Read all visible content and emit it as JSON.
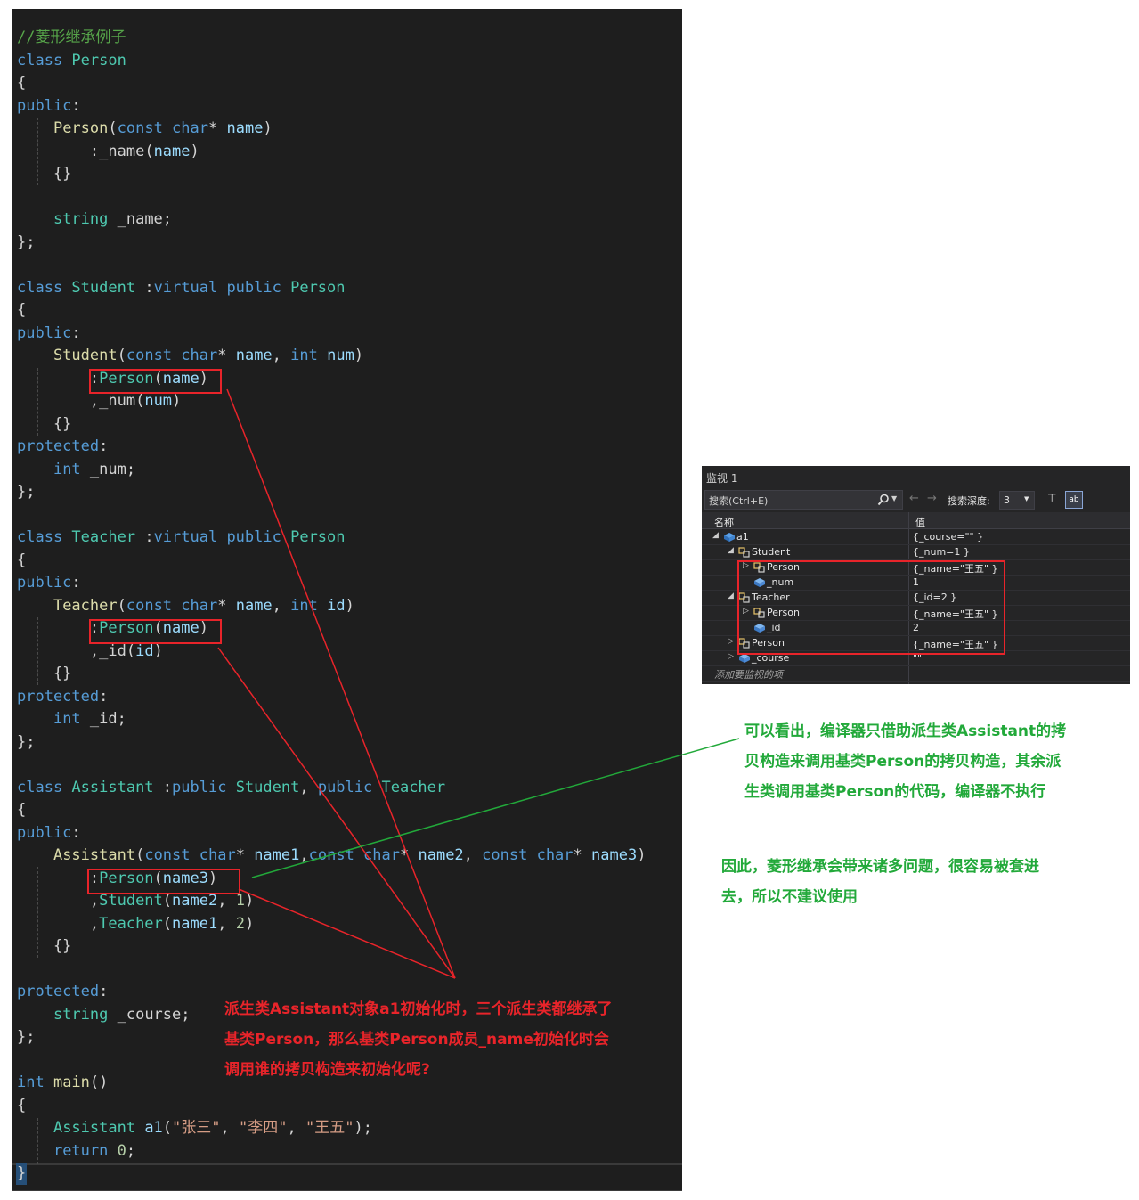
{
  "code_lines": [
    [
      [
        "cm",
        "//菱形继承例子"
      ]
    ],
    [
      [
        "kw",
        "class "
      ],
      [
        "ty",
        "Person"
      ]
    ],
    [
      [
        "pl",
        "{"
      ]
    ],
    [
      [
        "kw",
        "public"
      ],
      [
        "pl",
        ":"
      ]
    ],
    [
      [
        "pl",
        "    "
      ],
      [
        "fn",
        "Person"
      ],
      [
        "pl",
        "("
      ],
      [
        "kw",
        "const "
      ],
      [
        "kw",
        "char"
      ],
      [
        "pl",
        "* "
      ],
      [
        "pr",
        "name"
      ],
      [
        "pl",
        ")"
      ]
    ],
    [
      [
        "pl",
        "        :"
      ],
      [
        "pl",
        "_name"
      ],
      [
        "pl",
        "("
      ],
      [
        "pr",
        "name"
      ],
      [
        "pl",
        ")"
      ]
    ],
    [
      [
        "pl",
        "    {}"
      ]
    ],
    [
      [
        "pl",
        ""
      ]
    ],
    [
      [
        "pl",
        "    "
      ],
      [
        "ty",
        "string "
      ],
      [
        "pl",
        "_name;"
      ]
    ],
    [
      [
        "pl",
        "};"
      ]
    ],
    [
      [
        "pl",
        ""
      ]
    ],
    [
      [
        "kw",
        "class "
      ],
      [
        "ty",
        "Student "
      ],
      [
        "pl",
        ":"
      ],
      [
        "kw",
        "virtual public "
      ],
      [
        "ty",
        "Person"
      ]
    ],
    [
      [
        "pl",
        "{"
      ]
    ],
    [
      [
        "kw",
        "public"
      ],
      [
        "pl",
        ":"
      ]
    ],
    [
      [
        "pl",
        "    "
      ],
      [
        "fn",
        "Student"
      ],
      [
        "pl",
        "("
      ],
      [
        "kw",
        "const "
      ],
      [
        "kw",
        "char"
      ],
      [
        "pl",
        "* "
      ],
      [
        "pr",
        "name"
      ],
      [
        "pl",
        ", "
      ],
      [
        "kw",
        "int "
      ],
      [
        "pr",
        "num"
      ],
      [
        "pl",
        ")"
      ]
    ],
    [
      [
        "pl",
        "        :"
      ],
      [
        "ty",
        "Person"
      ],
      [
        "pl",
        "("
      ],
      [
        "pr",
        "name"
      ],
      [
        "pl",
        ")"
      ]
    ],
    [
      [
        "pl",
        "        ,"
      ],
      [
        "pl",
        "_num"
      ],
      [
        "pl",
        "("
      ],
      [
        "pr",
        "num"
      ],
      [
        "pl",
        ")"
      ]
    ],
    [
      [
        "pl",
        "    {}"
      ]
    ],
    [
      [
        "kw",
        "protected"
      ],
      [
        "pl",
        ":"
      ]
    ],
    [
      [
        "pl",
        "    "
      ],
      [
        "kw",
        "int "
      ],
      [
        "pl",
        "_num;"
      ]
    ],
    [
      [
        "pl",
        "};"
      ]
    ],
    [
      [
        "pl",
        ""
      ]
    ],
    [
      [
        "kw",
        "class "
      ],
      [
        "ty",
        "Teacher "
      ],
      [
        "pl",
        ":"
      ],
      [
        "kw",
        "virtual public "
      ],
      [
        "ty",
        "Person"
      ]
    ],
    [
      [
        "pl",
        "{"
      ]
    ],
    [
      [
        "kw",
        "public"
      ],
      [
        "pl",
        ":"
      ]
    ],
    [
      [
        "pl",
        "    "
      ],
      [
        "fn",
        "Teacher"
      ],
      [
        "pl",
        "("
      ],
      [
        "kw",
        "const "
      ],
      [
        "kw",
        "char"
      ],
      [
        "pl",
        "* "
      ],
      [
        "pr",
        "name"
      ],
      [
        "pl",
        ", "
      ],
      [
        "kw",
        "int "
      ],
      [
        "pr",
        "id"
      ],
      [
        "pl",
        ")"
      ]
    ],
    [
      [
        "pl",
        "        :"
      ],
      [
        "ty",
        "Person"
      ],
      [
        "pl",
        "("
      ],
      [
        "pr",
        "name"
      ],
      [
        "pl",
        ")"
      ]
    ],
    [
      [
        "pl",
        "        ,"
      ],
      [
        "pl",
        "_id"
      ],
      [
        "pl",
        "("
      ],
      [
        "pr",
        "id"
      ],
      [
        "pl",
        ")"
      ]
    ],
    [
      [
        "pl",
        "    {}"
      ]
    ],
    [
      [
        "kw",
        "protected"
      ],
      [
        "pl",
        ":"
      ]
    ],
    [
      [
        "pl",
        "    "
      ],
      [
        "kw",
        "int "
      ],
      [
        "pl",
        "_id;"
      ]
    ],
    [
      [
        "pl",
        "};"
      ]
    ],
    [
      [
        "pl",
        ""
      ]
    ],
    [
      [
        "kw",
        "class "
      ],
      [
        "ty",
        "Assistant "
      ],
      [
        "pl",
        ":"
      ],
      [
        "kw",
        "public "
      ],
      [
        "ty",
        "Student"
      ],
      [
        "pl",
        ", "
      ],
      [
        "kw",
        "public "
      ],
      [
        "ty",
        "Teacher"
      ]
    ],
    [
      [
        "pl",
        "{"
      ]
    ],
    [
      [
        "kw",
        "public"
      ],
      [
        "pl",
        ":"
      ]
    ],
    [
      [
        "pl",
        "    "
      ],
      [
        "fn",
        "Assistant"
      ],
      [
        "pl",
        "("
      ],
      [
        "kw",
        "const "
      ],
      [
        "kw",
        "char"
      ],
      [
        "pl",
        "* "
      ],
      [
        "pr",
        "name1"
      ],
      [
        "pl",
        ","
      ],
      [
        "kw",
        "const "
      ],
      [
        "kw",
        "char"
      ],
      [
        "pl",
        "* "
      ],
      [
        "pr",
        "name2"
      ],
      [
        "pl",
        ", "
      ],
      [
        "kw",
        "const "
      ],
      [
        "kw",
        "char"
      ],
      [
        "pl",
        "* "
      ],
      [
        "pr",
        "name3"
      ],
      [
        "pl",
        ")"
      ]
    ],
    [
      [
        "pl",
        "        :"
      ],
      [
        "ty",
        "Person"
      ],
      [
        "pl",
        "("
      ],
      [
        "pr",
        "name3"
      ],
      [
        "pl",
        ")"
      ]
    ],
    [
      [
        "pl",
        "        ,"
      ],
      [
        "ty",
        "Student"
      ],
      [
        "pl",
        "("
      ],
      [
        "pr",
        "name2"
      ],
      [
        "pl",
        ", "
      ],
      [
        "nu",
        "1"
      ],
      [
        "pl",
        ")"
      ]
    ],
    [
      [
        "pl",
        "        ,"
      ],
      [
        "ty",
        "Teacher"
      ],
      [
        "pl",
        "("
      ],
      [
        "pr",
        "name1"
      ],
      [
        "pl",
        ", "
      ],
      [
        "nu",
        "2"
      ],
      [
        "pl",
        ")"
      ]
    ],
    [
      [
        "pl",
        "    {}"
      ]
    ],
    [
      [
        "pl",
        ""
      ]
    ],
    [
      [
        "kw",
        "protected"
      ],
      [
        "pl",
        ":"
      ]
    ],
    [
      [
        "pl",
        "    "
      ],
      [
        "ty",
        "string "
      ],
      [
        "pl",
        "_course;"
      ]
    ],
    [
      [
        "pl",
        "};"
      ]
    ],
    [
      [
        "pl",
        ""
      ]
    ],
    [
      [
        "kw",
        "int "
      ],
      [
        "fn",
        "main"
      ],
      [
        "pl",
        "()"
      ]
    ],
    [
      [
        "pl",
        "{"
      ]
    ],
    [
      [
        "pl",
        "    "
      ],
      [
        "ty",
        "Assistant "
      ],
      [
        "pr",
        "a1"
      ],
      [
        "pl",
        "("
      ],
      [
        "st",
        "\"张三\""
      ],
      [
        "pl",
        ", "
      ],
      [
        "st",
        "\"李四\""
      ],
      [
        "pl",
        ", "
      ],
      [
        "st",
        "\"王五\""
      ],
      [
        "pl",
        ");"
      ]
    ],
    [
      [
        "pl",
        "    "
      ],
      [
        "kw",
        "return "
      ],
      [
        "nu",
        "0"
      ],
      [
        "pl",
        ";"
      ]
    ],
    [
      [
        "pl",
        "}"
      ]
    ]
  ],
  "watch": {
    "title": "监视 1",
    "search_placeholder": "搜索(Ctrl+E)",
    "depth_label": "搜索深度:",
    "depth_value": "3",
    "col_name": "名称",
    "col_value": "值",
    "add_item": "添加要监视的项",
    "rows": [
      {
        "name": "a1",
        "value": "{_course=\"\" }",
        "indent": 0,
        "expander": "▲",
        "icon": "var"
      },
      {
        "name": "Student",
        "value": "{_num=1 }",
        "indent": 1,
        "expander": "◢",
        "icon": "base"
      },
      {
        "name": "Person",
        "value": "{_name=\"王五\" }",
        "indent": 2,
        "expander": "▷",
        "icon": "base"
      },
      {
        "name": "_num",
        "value": "1",
        "indent": 2,
        "expander": "",
        "icon": "field"
      },
      {
        "name": "Teacher",
        "value": "{_id=2 }",
        "indent": 1,
        "expander": "◢",
        "icon": "base"
      },
      {
        "name": "Person",
        "value": "{_name=\"王五\" }",
        "indent": 2,
        "expander": "▷",
        "icon": "base"
      },
      {
        "name": "_id",
        "value": "2",
        "indent": 2,
        "expander": "",
        "icon": "field"
      },
      {
        "name": "Person",
        "value": "{_name=\"王五\" }",
        "indent": 1,
        "expander": "▷",
        "icon": "base"
      },
      {
        "name": "_course",
        "value": "\"\"",
        "indent": 1,
        "expander": "▷",
        "icon": "field"
      }
    ]
  },
  "annotations": {
    "green_note_lines": [
      "可以看出，编译器只借助派生类Assistant的拷",
      "贝构造来调用基类Person的拷贝构造，其余派",
      "生类调用基类Person的代码，编译器不执行"
    ],
    "conclusion_lines": [
      "因此，菱形继承会带来诸多问题，很容易被套进",
      "去，所以不建议使用"
    ],
    "question_lines": [
      "派生类Assistant对象a1初始化时，三个派生类都继承了",
      "基类Person，那么基类Person成员_name初始化时会",
      "调用谁的拷贝构造来初始化呢?"
    ]
  },
  "colors": {
    "red": "#e8242a",
    "green": "#22a93a",
    "editor_bg": "#1e1e1e"
  }
}
